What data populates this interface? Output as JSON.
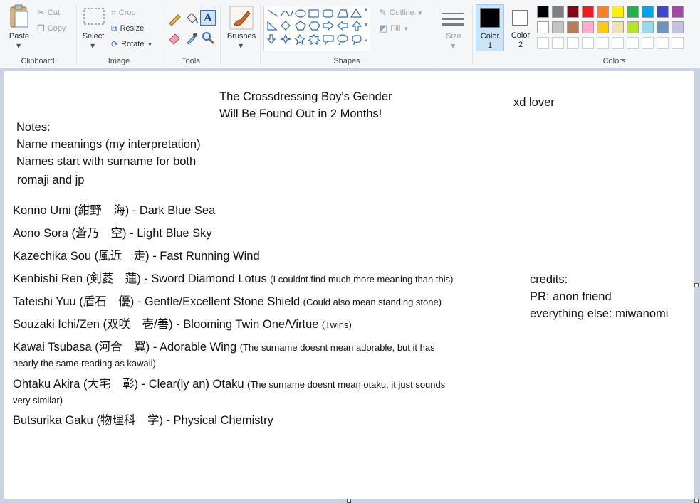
{
  "ribbon": {
    "clipboard": {
      "paste": "Paste",
      "cut": "Cut",
      "copy": "Copy",
      "label": "Clipboard"
    },
    "image": {
      "select": "Select",
      "crop": "Crop",
      "resize": "Resize",
      "rotate": "Rotate",
      "label": "Image"
    },
    "tools": {
      "label": "Tools",
      "text_tool": "A"
    },
    "brushes": {
      "label": "Brushes"
    },
    "shapes": {
      "label": "Shapes",
      "outline": "Outline",
      "fill": "Fill"
    },
    "size": {
      "label": "Size"
    },
    "color1": {
      "label_line1": "Color",
      "label_line2": "1",
      "value": "#000000"
    },
    "color2": {
      "label_line1": "Color",
      "label_line2": "2",
      "value": "#ffffff"
    },
    "colors": {
      "label": "Colors",
      "row1": [
        "#000000",
        "#7f7f7f",
        "#880015",
        "#ed1c24",
        "#ff7f27",
        "#fff200",
        "#22b14c",
        "#00a2e8",
        "#3f48cc",
        "#a349a4"
      ],
      "row2": [
        "#ffffff",
        "#c3c3c3",
        "#b97a57",
        "#ffaec9",
        "#ffc90e",
        "#efe4b0",
        "#b5e61d",
        "#99d9ea",
        "#7092be",
        "#c8bfe7"
      ],
      "row3": [
        "#ffffff",
        "#ffffff",
        "#ffffff",
        "#ffffff",
        "#ffffff",
        "#ffffff",
        "#ffffff",
        "#ffffff",
        "#ffffff",
        "#ffffff"
      ]
    }
  },
  "canvas": {
    "title_line1": "The Crossdressing Boy's Gender",
    "title_line2": "Will Be Found Out in 2 Months!",
    "corner": "xd lover",
    "notes": [
      "Notes:",
      "Name meanings (my interpretation)",
      "Names start with surname for both",
      "romaji and jp"
    ],
    "names": [
      {
        "main": "Konno Umi (紺野　海) - Dark Blue Sea",
        "note": ""
      },
      {
        "main": "Aono Sora (蒼乃　空) - Light Blue Sky",
        "note": ""
      },
      {
        "main": "Kazechika Sou (風近　走) - Fast Running Wind",
        "note": ""
      },
      {
        "main": "Kenbishi Ren (剣菱　蓮) - Sword Diamond Lotus",
        "note": "(I couldnt find much more meaning than this)"
      },
      {
        "main": "Tateishi Yuu (盾石　優) - Gentle/Excellent Stone Shield",
        "note": "(Could also mean standing stone)"
      },
      {
        "main": "Souzaki Ichi/Zen (双咲　壱/善) - Blooming Twin One/Virtue",
        "note": "(Twins)"
      },
      {
        "main": "Kawai Tsubasa (河合　翼) - Adorable Wing",
        "note": "(The surname doesnt mean adorable, but it has",
        "note2": "nearly the same reading as kawaii)"
      },
      {
        "main": "Ohtaku Akira (大宅　彰) - Clear(ly an) Otaku",
        "note": "(The surname doesnt mean otaku, it just sounds",
        "note2": "very similar)"
      },
      {
        "main": "Butsurika Gaku (物理科　学) - Physical Chemistry",
        "note": ""
      }
    ],
    "credits": [
      "credits:",
      "PR: anon friend",
      "everything else: miwanomi"
    ]
  }
}
